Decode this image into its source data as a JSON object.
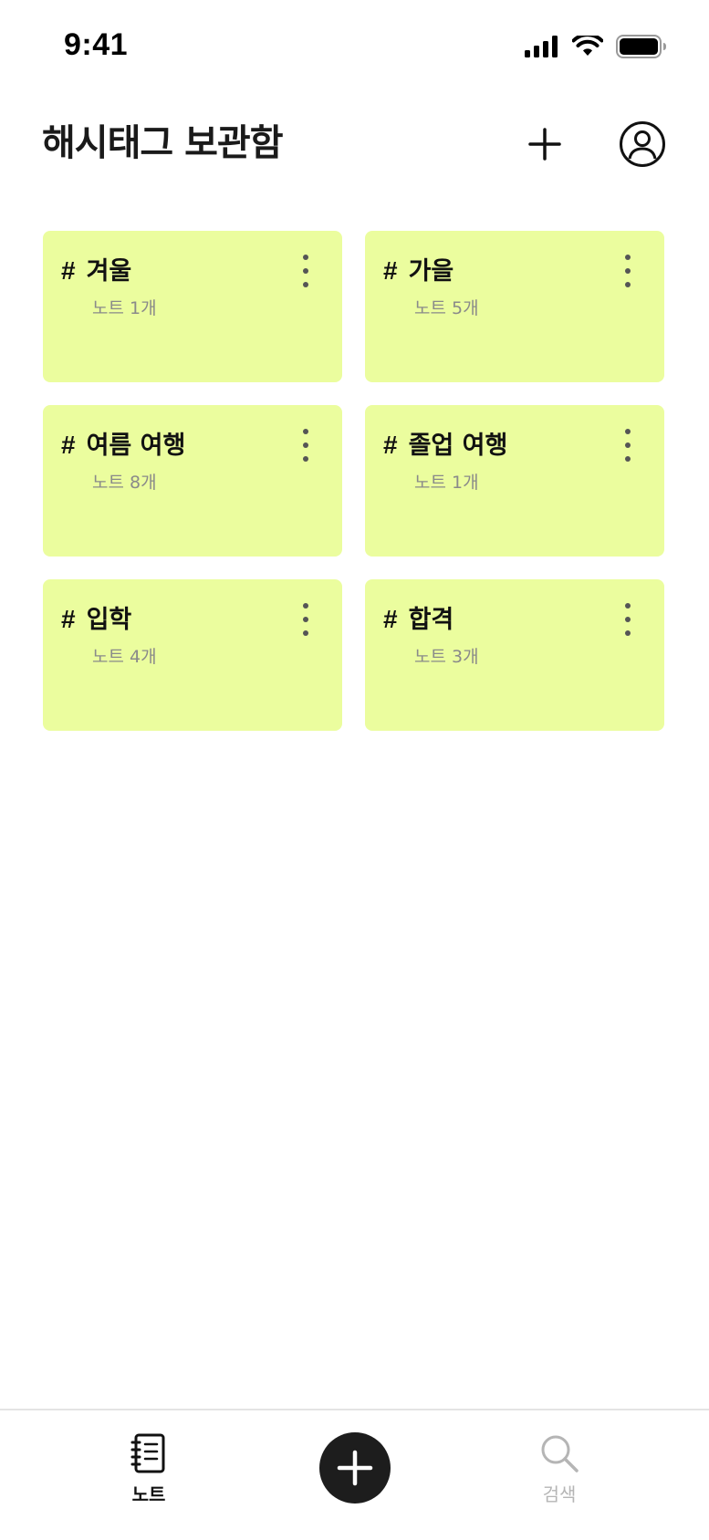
{
  "status_bar": {
    "time": "9:41"
  },
  "header": {
    "title": "해시태그 보관함"
  },
  "hashtags": [
    {
      "hash": "#",
      "name": "겨울",
      "count": "노트 1개"
    },
    {
      "hash": "#",
      "name": "가을",
      "count": "노트 5개"
    },
    {
      "hash": "#",
      "name": "여름 여행",
      "count": "노트 8개"
    },
    {
      "hash": "#",
      "name": "졸업 여행",
      "count": "노트 1개"
    },
    {
      "hash": "#",
      "name": "입학",
      "count": "노트 4개"
    },
    {
      "hash": "#",
      "name": "합격",
      "count": "노트 3개"
    }
  ],
  "tabbar": {
    "notes_label": "노트",
    "search_label": "검색",
    "active_tab": "노트"
  },
  "colors": {
    "card_background": "#ebfd9e",
    "fab_background": "#1d1d1d",
    "text_primary": "#1a1a1a",
    "text_secondary": "#8a8a8a",
    "tab_inactive": "#b5b5b5"
  },
  "icons": {
    "status": [
      "cellular-signal-icon",
      "wifi-icon",
      "battery-icon"
    ],
    "header": [
      "plus-icon",
      "profile-icon"
    ],
    "card": "more-vertical-icon",
    "tabbar": [
      "notebook-icon",
      "plus-icon",
      "search-icon"
    ]
  }
}
